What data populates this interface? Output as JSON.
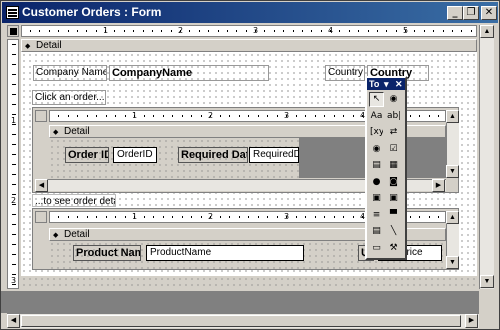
{
  "window": {
    "title": "Customer Orders : Form",
    "controls": {
      "minimize": "_",
      "restore": "❐",
      "close": "✕"
    }
  },
  "ruler": {
    "numbers": [
      "1",
      "2",
      "3",
      "4",
      "5"
    ],
    "vnumbers": [
      "1",
      "2",
      "3"
    ]
  },
  "main": {
    "detail_label": "Detail",
    "company_label": "Company Name",
    "company_field": "CompanyName",
    "country_label": "Country",
    "country_field": "Country",
    "click_label": "Click an order...",
    "see_details_label": "...to see order details."
  },
  "orders_subform": {
    "ruler_numbers": [
      "1",
      "2",
      "3",
      "4"
    ],
    "detail_label": "Detail",
    "order_id_label": "Order ID",
    "order_id_field": "OrderID",
    "required_date_label": "Required Date",
    "required_date_field": "RequiredDat"
  },
  "details_subform": {
    "ruler_numbers": [
      "1",
      "2",
      "3",
      "4"
    ],
    "detail_label": "Detail",
    "product_label": "Product Name",
    "product_field": "ProductName",
    "unit_label": "U",
    "unitprice_field": "UnitPrice"
  },
  "toolbox": {
    "title": "To",
    "dropdown": "▾",
    "close": "✕",
    "tools": [
      {
        "name": "select-objects",
        "glyph": "↖"
      },
      {
        "name": "control-wizards",
        "glyph": "◉"
      },
      {
        "name": "label",
        "glyph": "Aa"
      },
      {
        "name": "text-box",
        "glyph": "ab|"
      },
      {
        "name": "option-group",
        "glyph": "[xyz]"
      },
      {
        "name": "toggle-button",
        "glyph": "⇄"
      },
      {
        "name": "option-button",
        "glyph": "◉"
      },
      {
        "name": "check-box",
        "glyph": "☑"
      },
      {
        "name": "combo-box",
        "glyph": "▤"
      },
      {
        "name": "list-box",
        "glyph": "▦"
      },
      {
        "name": "command-button",
        "glyph": "●"
      },
      {
        "name": "image",
        "glyph": "◙"
      },
      {
        "name": "unbound-object-frame",
        "glyph": "▣"
      },
      {
        "name": "bound-object-frame",
        "glyph": "▣"
      },
      {
        "name": "page-break",
        "glyph": "≡"
      },
      {
        "name": "tab-control",
        "glyph": "▀"
      },
      {
        "name": "subform",
        "glyph": "▤"
      },
      {
        "name": "line",
        "glyph": "╲"
      },
      {
        "name": "rectangle",
        "glyph": "▭"
      },
      {
        "name": "more-controls",
        "glyph": "⚒"
      }
    ]
  },
  "colors": {
    "titlebar": "#0a246a",
    "face": "#d4d0c8"
  }
}
